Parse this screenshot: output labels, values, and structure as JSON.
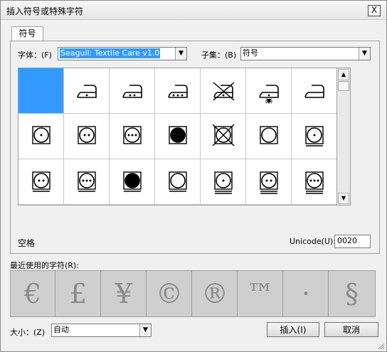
{
  "window": {
    "title": "插入符号或特殊字符",
    "close_glyph": "X"
  },
  "tabs": [
    {
      "label": "符号"
    }
  ],
  "font": {
    "label": "字体：(F)",
    "value": "Seagull: Textile Care v1.0"
  },
  "subset": {
    "label": "子集：(B)",
    "value": "符号"
  },
  "symbol_grid": {
    "rows": [
      [
        "blank-selected",
        "iron-1dot",
        "iron-2dots",
        "iron-3dots",
        "iron-crossed",
        "iron-steam-star",
        "iron-plain"
      ],
      [
        "dryer-1dot",
        "dryer-2dots",
        "dryer-3dots",
        "dryer-filled",
        "dryer-crossed",
        "dryer-empty",
        "dryer-1dot-bar"
      ],
      [
        "dryer-2dots-bar",
        "dryer-3dots-bar",
        "dryer-filled-bar",
        "dryer-empty-bar",
        "dryer-1dot-2bars",
        "dryer-2dots-2bars",
        "dryer-3dots-2bars"
      ]
    ],
    "selected_index": 0
  },
  "char_name": "空格",
  "unicode": {
    "label": "Unicode(U):",
    "value": "0020"
  },
  "recent": {
    "label": "最近使用的字符(R):",
    "chars": [
      "€",
      "£",
      "¥",
      "©",
      "®",
      "™",
      "·",
      "§"
    ]
  },
  "size": {
    "label": "大小：(Z)",
    "value": "自动"
  },
  "buttons": {
    "insert": "插入(I)",
    "cancel": "取消"
  },
  "icons": {
    "dropdown": "chevron-down-icon",
    "scroll_up": "chevron-up-icon",
    "scroll_down": "chevron-down-icon"
  }
}
